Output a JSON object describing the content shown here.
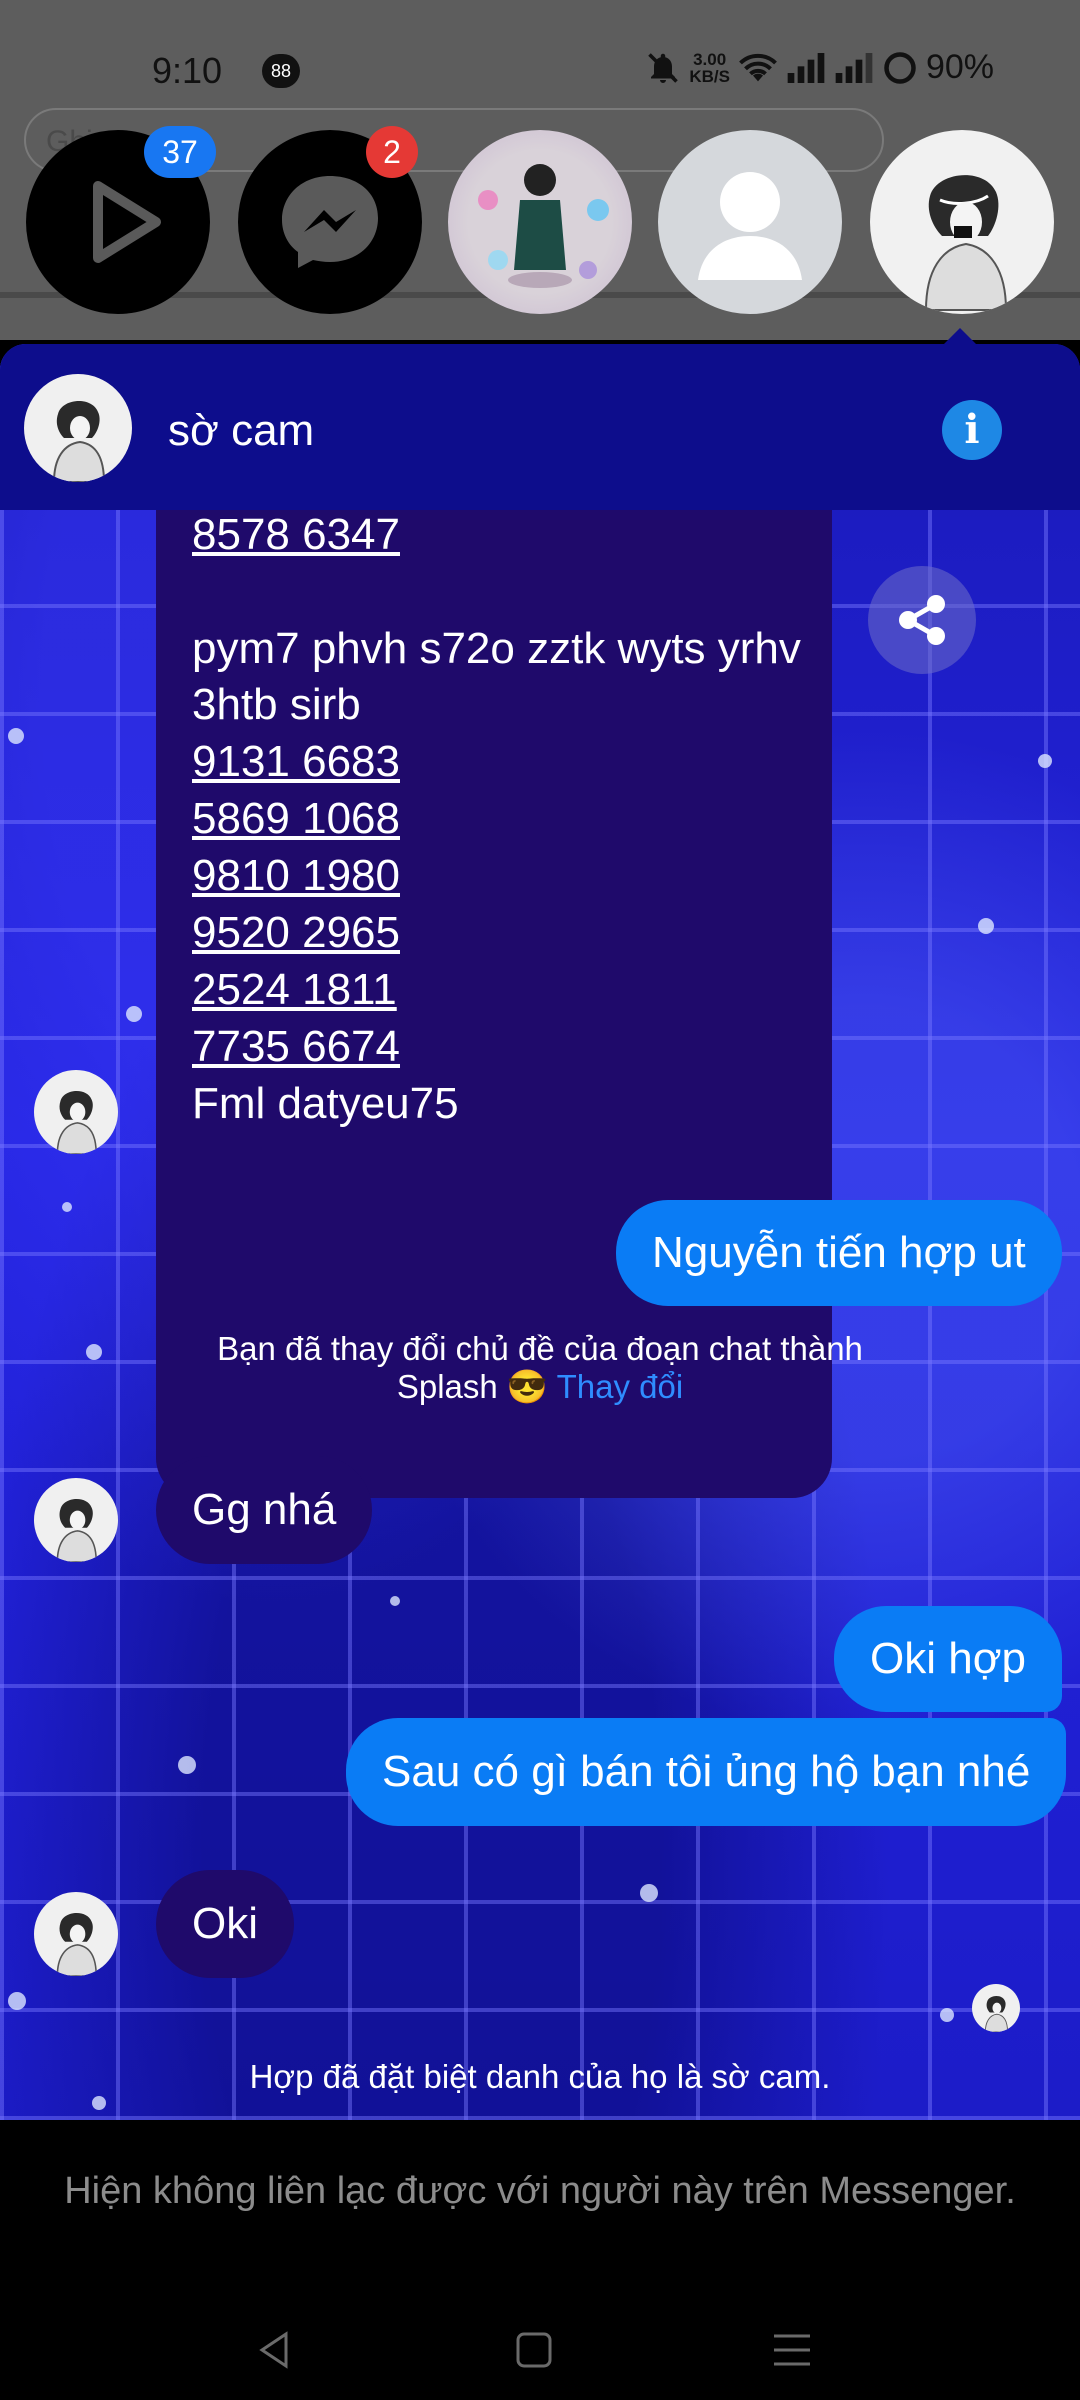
{
  "background_app": {
    "search_partial": "Ghi"
  },
  "status_bar": {
    "time": "9:10",
    "notification_count": "88",
    "net_speed_value": "3.00",
    "net_speed_unit": "KB/S",
    "battery": "90%"
  },
  "chat_heads": {
    "play_badge": "37",
    "messenger_badge": "2"
  },
  "chat": {
    "contact_name": "sờ cam",
    "big_message": {
      "line1": "8578 6347",
      "line2": "pym7 phvh s72o zztk wyts yrhv",
      "line3": "3htb sirb",
      "codes": [
        "9131 6683",
        "5869 1068",
        "9810 1980",
        "9520 2965",
        "2524 1811",
        "7735 6674"
      ],
      "last": "Fml datyeu75"
    },
    "out1": "Nguyễn tiến hợp ut",
    "system1_line1": "Bạn đã thay đổi chủ đề của đoạn chat thành",
    "system1_line2": "Splash 😎",
    "system1_link": "Thay đổi",
    "in2": "Gg nhá",
    "out2": "Oki hợp",
    "out3": "Sau có gì bán tôi ủng hộ bạn nhé",
    "in3": "Oki",
    "system2": "Hợp đã đặt biệt danh của họ là sờ cam."
  },
  "footer": {
    "blocked_notice": "Hiện không liên lạc được với người này trên Messenger."
  }
}
